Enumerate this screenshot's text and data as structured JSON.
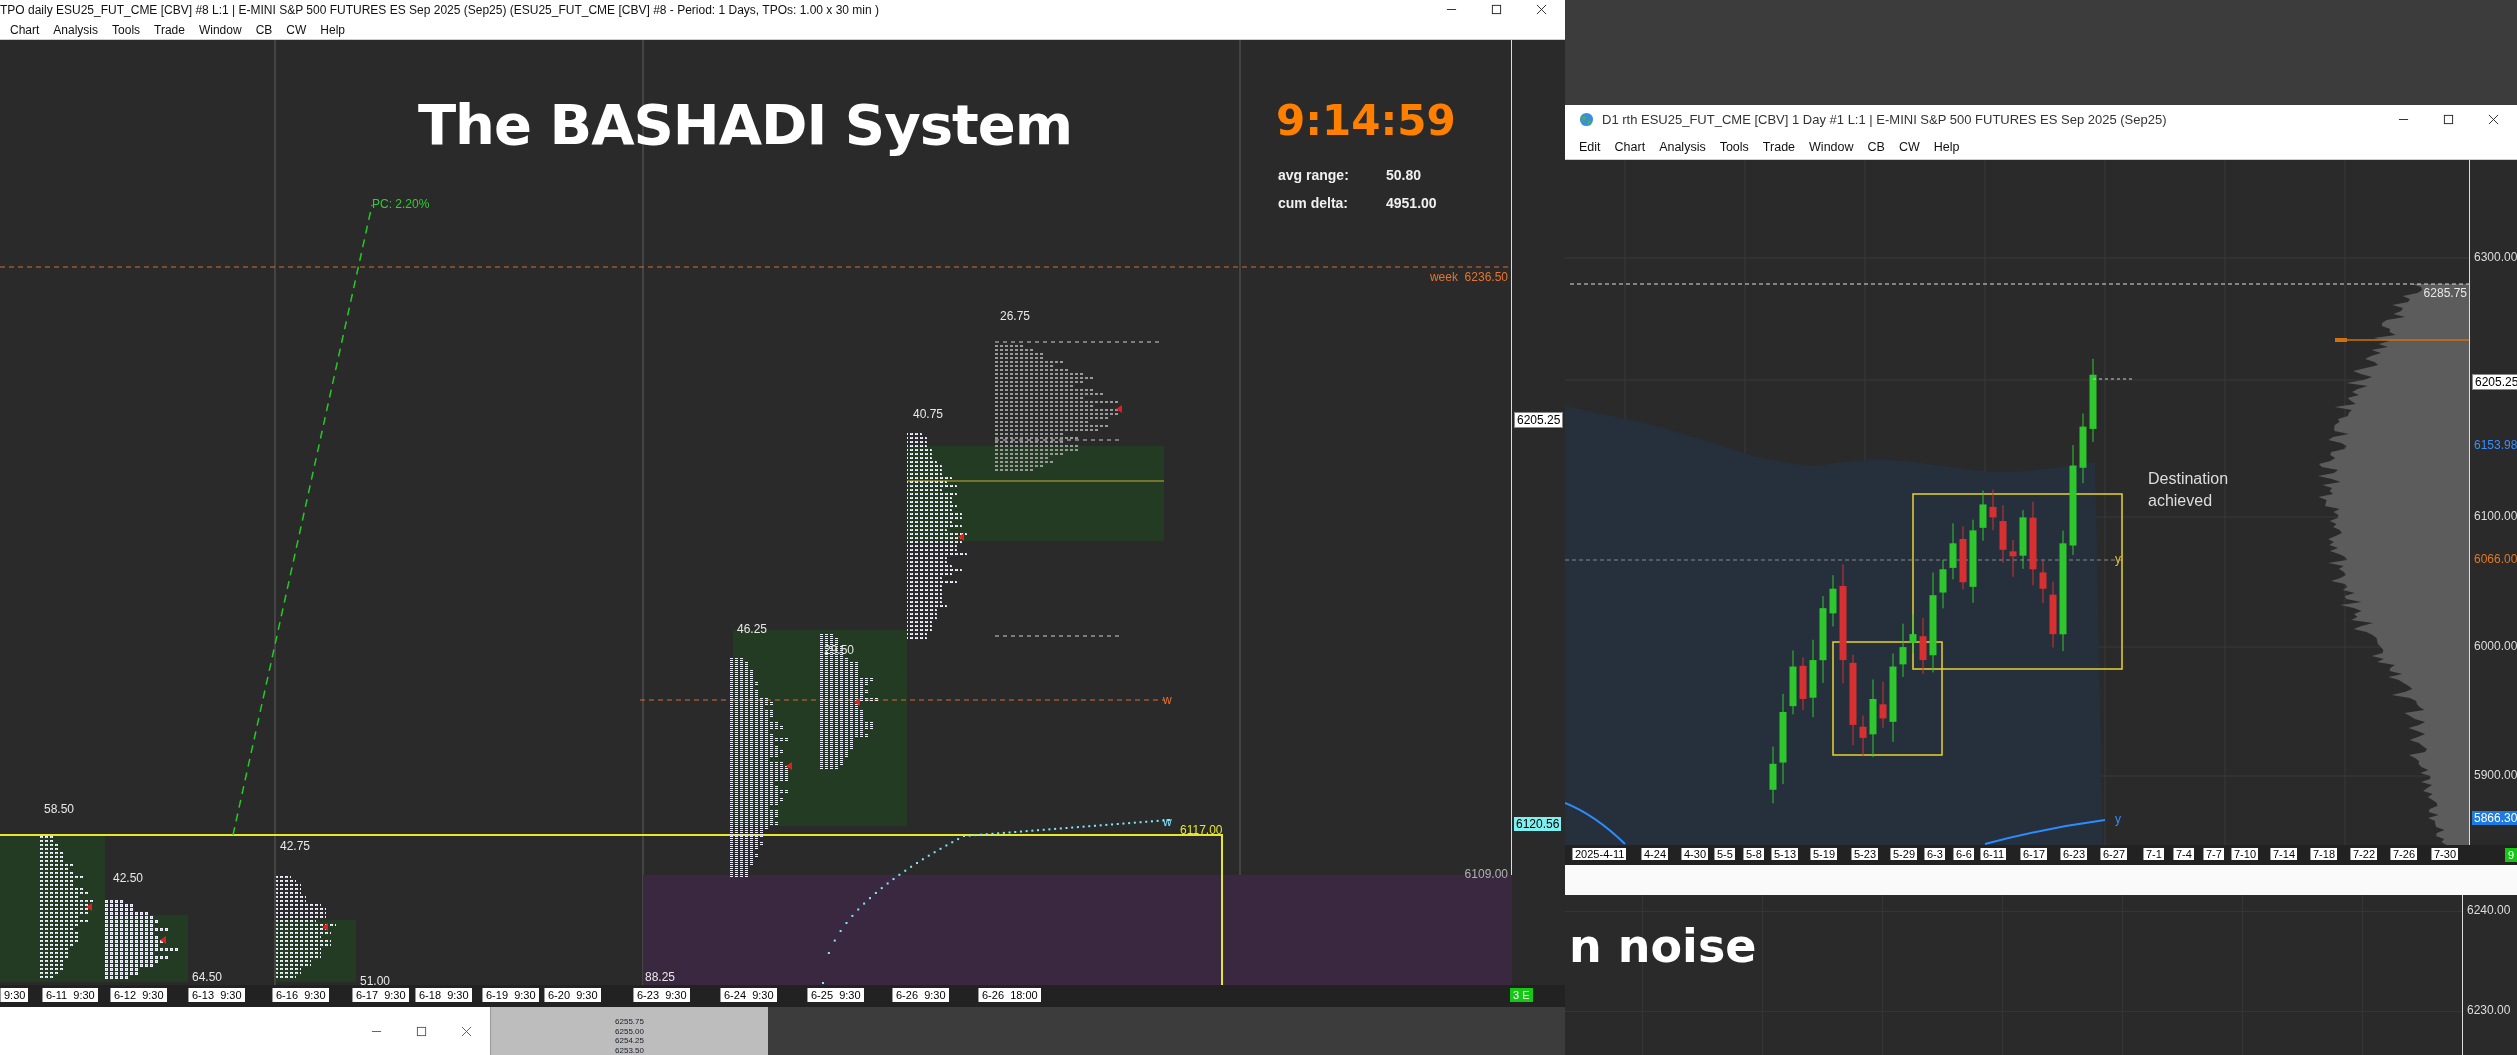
{
  "left_window": {
    "title": "TPO daily ESU25_FUT_CME [CBV] #8 L:1 | E-MINI S&P 500 FUTURES ES Sep 2025 (Sep25) (ESU25_FUT_CME [CBV] #8 - Period: 1 Days, TPOs: 1.00 x 30 min  )",
    "menu": [
      "Chart",
      "Analysis",
      "Tools",
      "Trade",
      "Window",
      "CB",
      "CW",
      "Help"
    ],
    "chart": {
      "heading": "The BASHADI System",
      "clock": "9:14:59",
      "stats": [
        {
          "label": "avg range:",
          "value": "50.80"
        },
        {
          "label": "cum delta:",
          "value": "4951.00"
        }
      ],
      "line_labels": [
        {
          "text": "PC: 2.20%",
          "kind": "trend"
        },
        {
          "text": "week  6236.50",
          "kind": "week"
        },
        {
          "text": "w",
          "kind": "week"
        },
        {
          "text": "w",
          "kind": "vwap"
        },
        {
          "text": "6117.00",
          "kind": "box"
        },
        {
          "text": "6109.00",
          "kind": "plain"
        }
      ],
      "range_labels": [
        "26.75",
        "40.75",
        "46.25",
        "29.50",
        "58.50",
        "42.50",
        "42.75",
        "64.50",
        "51.00",
        "88.25"
      ],
      "price_axis": [
        {
          "text": "6205.25",
          "kind": "last"
        },
        {
          "text": "6120.56",
          "kind": "vwap"
        }
      ],
      "time_axis": [
        "9:30",
        "6-11  9:30",
        "6-12  9:30",
        "6-13  9:30",
        "6-16  9:30",
        "6-17  9:30",
        "6-18  9:30",
        "6-19  9:30",
        "6-20  9:30",
        "6-23  9:30",
        "6-24  9:30",
        "6-25  9:30",
        "6-26  9:30",
        "6-26  18:00"
      ],
      "status_badge": "3 E"
    }
  },
  "bottom_left_window": {
    "price_cells": [
      "6255.75",
      "6255.00",
      "6254.25",
      "6253.50"
    ]
  },
  "right_window": {
    "title": "D1 rth ESU25_FUT_CME [CBV]  1 Day  #1 L:1 | E-MINI S&P 500 FUTURES ES Sep 2025 (Sep25)",
    "menu": [
      "Edit",
      "Chart",
      "Analysis",
      "Tools",
      "Trade",
      "Window",
      "CB",
      "CW",
      "Help"
    ],
    "chart": {
      "note": "Destination achieved",
      "line_labels": [
        {
          "text": "6285.75",
          "kind": "high"
        },
        {
          "text": "y",
          "kind": "level"
        },
        {
          "text": "y",
          "kind": "average"
        }
      ],
      "price_axis": [
        {
          "text": "6300.00",
          "kind": "tick"
        },
        {
          "text": "6205.25",
          "kind": "last"
        },
        {
          "text": "6153.98",
          "kind": "average"
        },
        {
          "text": "6100.00",
          "kind": "tick"
        },
        {
          "text": "6066.00",
          "kind": "level"
        },
        {
          "text": "6000.00",
          "kind": "tick"
        },
        {
          "text": "5900.00",
          "kind": "tick"
        },
        {
          "text": "5866.30",
          "kind": "average_last"
        }
      ],
      "time_axis": [
        "2025-4-11",
        "4-24",
        "4-30",
        "5-5",
        "5-8",
        "5-13",
        "5-19",
        "5-23",
        "5-29",
        "6-3",
        "6-6",
        "6-11",
        "6-17",
        "6-23",
        "6-27",
        "7-1",
        "7-4",
        "7-7",
        "7-10",
        "7-14",
        "7-18",
        "7-22",
        "7-26",
        "7-30"
      ],
      "status_badge": "9"
    }
  },
  "lower_right_chart": {
    "heading": "n noise",
    "price_axis": [
      "6240.00",
      "6230.00"
    ]
  }
}
